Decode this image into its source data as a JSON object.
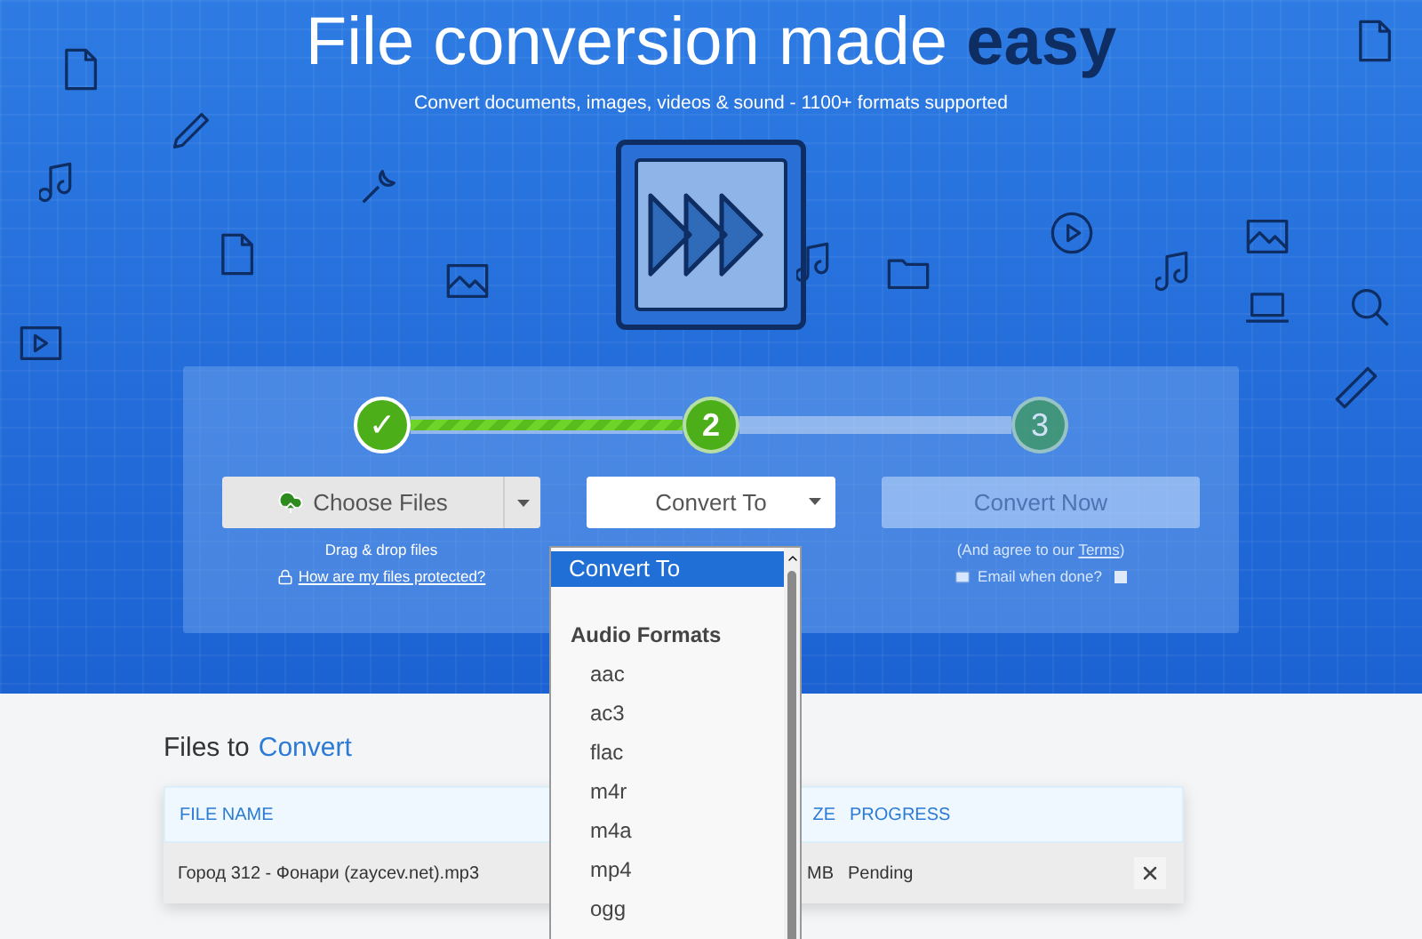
{
  "hero": {
    "title": "File conversion made **easy**",
    "subtitle": "Convert documents, images, videos & sound - 1100+ formats supported"
  },
  "steps": [
    {
      "label": "✓",
      "done": true,
      "current": false
    },
    {
      "label": "2",
      "done": false,
      "current": true
    },
    {
      "label": "3",
      "done": false,
      "current": false
    }
  ],
  "connectors": [
    {
      "level": 1
    },
    {
      "level": 0
    }
  ],
  "choose_files": {
    "label": "Choose Files",
    "hint": "Drag & drop files",
    "link": "How are my files protected?"
  },
  "convert_to": {
    "label": "Convert To"
  },
  "convert_now": {
    "label": "Convert Now",
    "disabled": true,
    "note_before": "(And agree to our ",
    "note_link": "Terms",
    "note_after": ")",
    "email_label": "Email when done?",
    "email_checked": false
  },
  "dropdown": [
    {
      "label": "Convert To",
      "kind": "option",
      "selected": true
    },
    {
      "label": "Audio Formats",
      "kind": "group",
      "selected": false
    },
    {
      "label": "aac",
      "kind": "option",
      "selected": false
    },
    {
      "label": "ac3",
      "kind": "option",
      "selected": false
    },
    {
      "label": "flac",
      "kind": "option",
      "selected": false
    },
    {
      "label": "m4r",
      "kind": "option",
      "selected": false
    },
    {
      "label": "m4a",
      "kind": "option",
      "selected": false
    },
    {
      "label": "mp4",
      "kind": "option",
      "selected": false
    },
    {
      "label": "ogg",
      "kind": "option",
      "selected": false
    }
  ],
  "files": {
    "heading": "Files to",
    "heading_accent": "Convert",
    "columns": [
      "FILE NAME",
      "ZE",
      "PROGRESS"
    ],
    "rows": [
      {
        "file_name": "Город 312 - Фонари (zaycev.net).mp3",
        "column_2": "MB",
        "progress": "Pending"
      }
    ]
  }
}
